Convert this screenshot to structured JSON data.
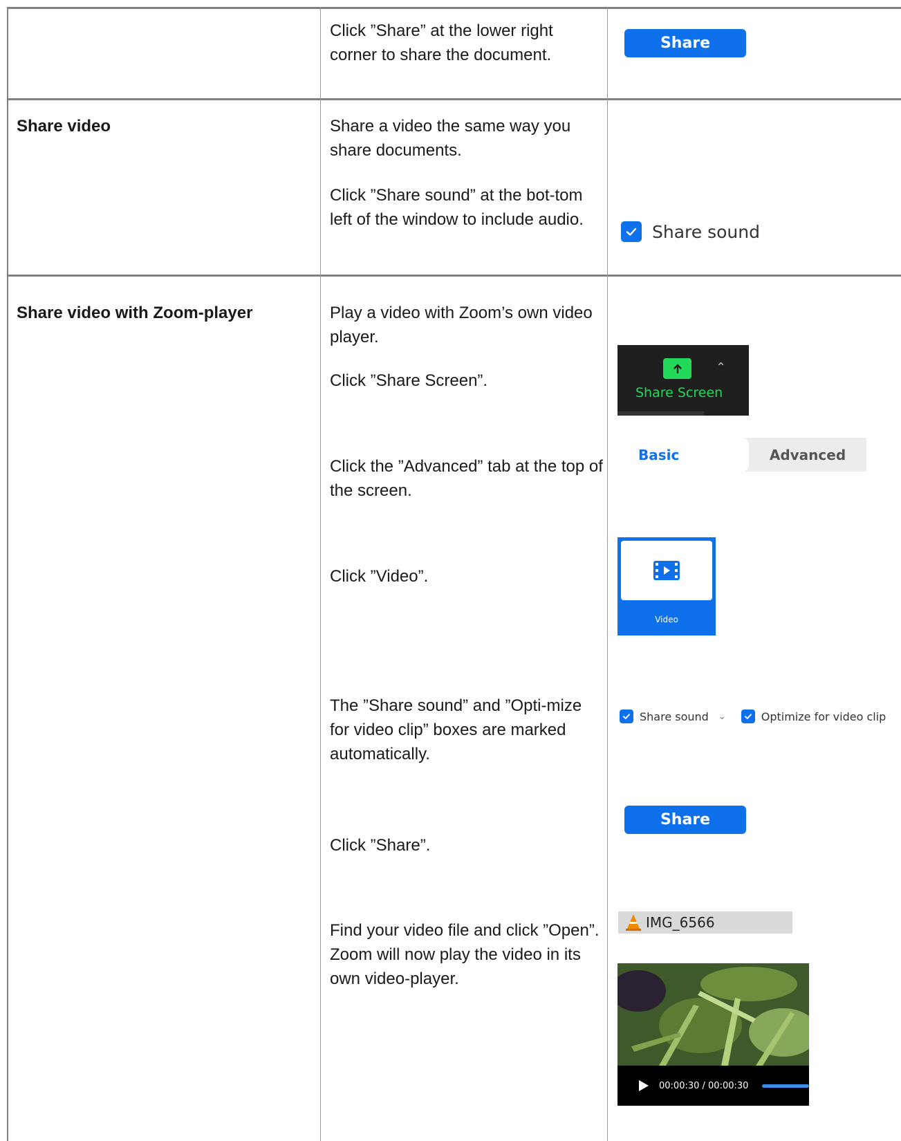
{
  "rows": [
    {
      "title": "",
      "steps": [
        "Click ”Share” at the lower right corner to share the document."
      ]
    },
    {
      "title": "Share video",
      "steps": [
        "Share a video the same way you share documents.",
        "Click ”Share sound” at the bot-tom left of the window to include audio."
      ]
    },
    {
      "title": "Share video with Zoom-player",
      "steps": [
        "Play a video with Zoom’s own video player.",
        "Click ”Share Screen”.",
        "Click the ”Advanced” tab at the top of the screen.",
        "Click ”Video”.",
        "The ”Share sound” and ”Opti-mize for video clip” boxes are marked automatically.",
        "Click ”Share”.",
        "Find your video file and click ”Open”. Zoom will now play the video in its own video-player."
      ]
    }
  ],
  "widgets": {
    "share_button_label": "Share",
    "share_sound_label": "Share sound",
    "share_screen_label": "Share Screen",
    "tab_basic": "Basic",
    "tab_advanced": "Advanced",
    "video_tile_label": "Video",
    "opt_share_sound": "Share sound",
    "opt_optimize": "Optimize for video clip",
    "file_name": "IMG_6566",
    "player_time": "00:00:30 / 00:00:30"
  },
  "colors": {
    "zoom_blue": "#0e71eb",
    "zoom_green": "#23d959"
  }
}
